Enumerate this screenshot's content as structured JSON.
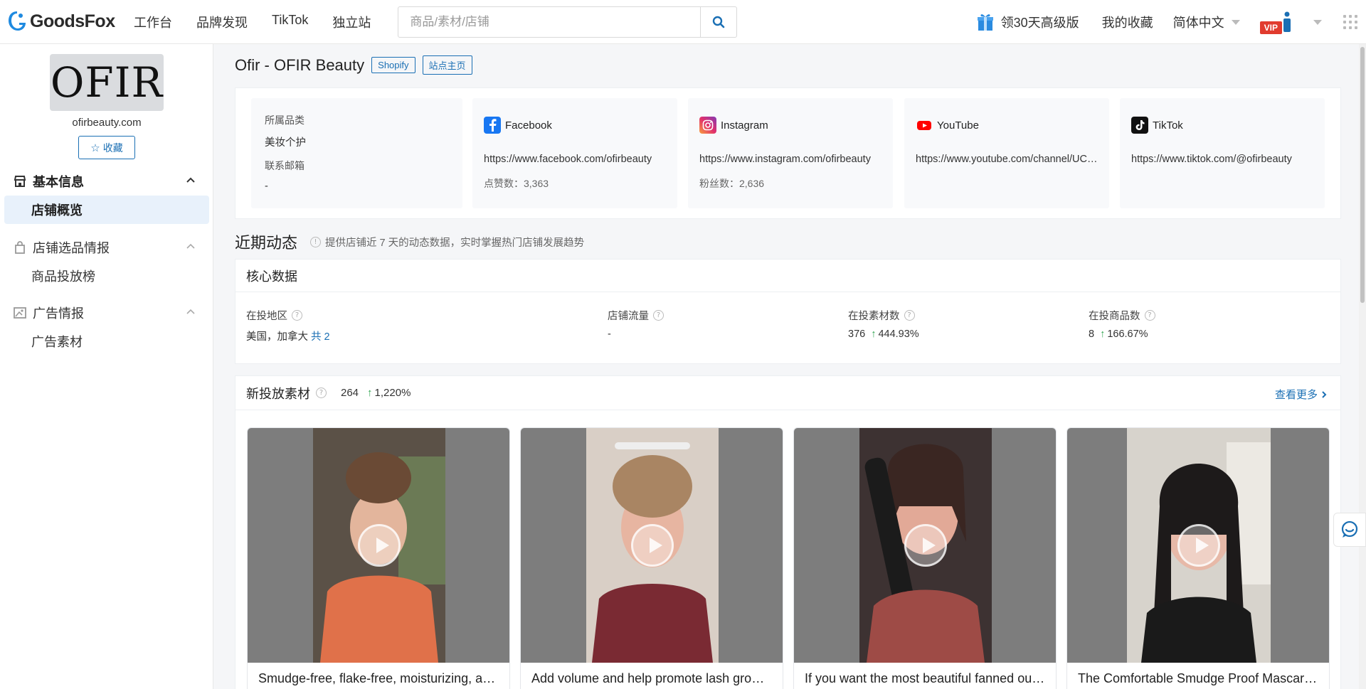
{
  "header": {
    "logo_text": "GoodsFox",
    "nav": [
      "工作台",
      "品牌发现",
      "TikTok",
      "独立站"
    ],
    "search_placeholder": "商品/素材/店铺",
    "promo": "领30天高级版",
    "favorites": "我的收藏",
    "language": "简体中文",
    "vip": "VIP"
  },
  "sidebar": {
    "logo_text": "OFIR",
    "domain": "ofirbeauty.com",
    "fav_label": "收藏",
    "groups": [
      {
        "title": "基本信息",
        "items": [
          "店铺概览"
        ]
      },
      {
        "title": "店铺选品情报",
        "items": [
          "商品投放榜"
        ]
      },
      {
        "title": "广告情报",
        "items": [
          "广告素材"
        ]
      }
    ]
  },
  "store": {
    "name": "Ofir - OFIR Beauty",
    "tags": [
      "Shopify",
      "站点主页"
    ],
    "category_label": "所属品类",
    "category_value": "美妆个护",
    "email_label": "联系邮箱",
    "email_value": "-",
    "socials": [
      {
        "name": "Facebook",
        "url": "https://www.facebook.com/ofirbeauty",
        "stat": "点赞数：3,363"
      },
      {
        "name": "Instagram",
        "url": "https://www.instagram.com/ofirbeauty",
        "stat": "粉丝数：2,636"
      },
      {
        "name": "YouTube",
        "url": "https://www.youtube.com/channel/UCxxxxxxxxxxxxxxxx",
        "stat": ""
      },
      {
        "name": "TikTok",
        "url": "https://www.tiktok.com/@ofirbeauty",
        "stat": ""
      }
    ]
  },
  "recent": {
    "title": "近期动态",
    "hint": "提供店铺近 7 天的动态数据，实时掌握热门店铺发展趋势"
  },
  "core": {
    "title": "核心数据",
    "metrics": [
      {
        "label": "在投地区",
        "value": "美国，加拿大",
        "link": "共 2",
        "change": ""
      },
      {
        "label": "店铺流量",
        "value": "-",
        "link": "",
        "change": ""
      },
      {
        "label": "在投素材数",
        "value": "376",
        "link": "",
        "change": "444.93%"
      },
      {
        "label": "在投商品数",
        "value": "8",
        "link": "",
        "change": "166.67%"
      }
    ]
  },
  "new_materials": {
    "title": "新投放素材",
    "count": "264",
    "change": "1,220%",
    "more": "查看更多",
    "cards": [
      {
        "caption": "Smudge-free, flake-free, moisturizing, and lengthening mascara",
        "bg": "#d8774e"
      },
      {
        "caption": "Add volume and help promote lash growth with our mascara",
        "bg": "#7a2a33"
      },
      {
        "caption": "If you want the most beautiful fanned out lashes",
        "bg": "#8e3a3e"
      },
      {
        "caption": "The Comfortable Smudge Proof Mascara you need",
        "bg": "#2a2a2e"
      }
    ]
  },
  "colors": {
    "brand": "#1a6fb4",
    "up": "#2ea44f",
    "vip": "#e13b2e"
  }
}
